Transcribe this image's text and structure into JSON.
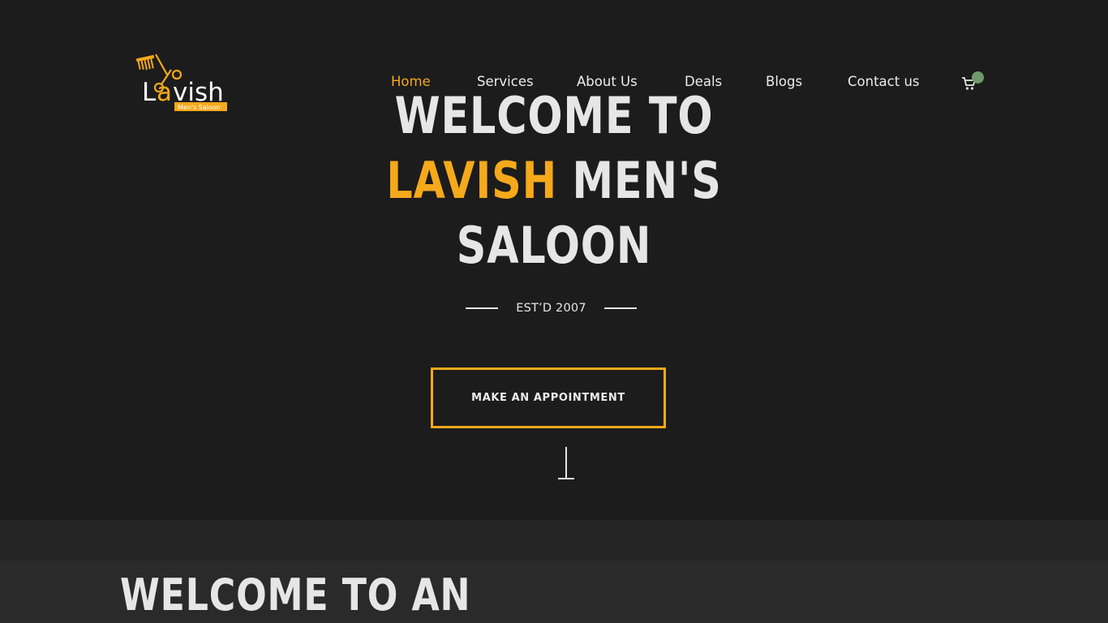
{
  "brand": {
    "name": "Lavish",
    "tagline": "Men's Saloon",
    "accent_color": "#f5a91b"
  },
  "nav": {
    "items": [
      {
        "label": "Home",
        "active": true
      },
      {
        "label": "Services",
        "active": false
      },
      {
        "label": "About Us",
        "active": false
      },
      {
        "label": "Deals",
        "active": false
      },
      {
        "label": "Blogs",
        "active": false
      },
      {
        "label": "Contact us",
        "active": false
      }
    ],
    "cart_icon": "cart-icon"
  },
  "hero": {
    "title_line1": "WELCOME TO",
    "title_accent": "LAVISH",
    "title_line2_rest": " MEN'S",
    "title_line3": "SALOON",
    "established": "EST’D 2007",
    "cta_label": "MAKE AN APPOINTMENT",
    "scroll_icon": "scroll-down-icon"
  },
  "intro": {
    "title": "WELCOME TO AN"
  },
  "colors": {
    "background": "#1c1c1c",
    "band": "#252525",
    "intro_bg": "#2a2a2a",
    "text": "#e6e6e6",
    "cart_badge": "#6f9a6a"
  }
}
